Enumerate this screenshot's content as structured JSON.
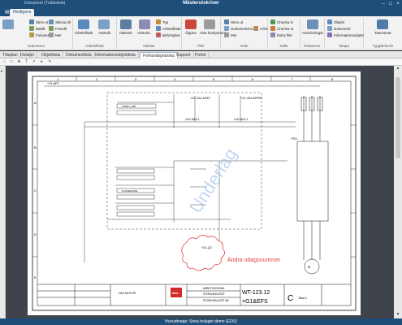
{
  "window": {
    "tab_title": "Dokument (Tvådiskett)",
    "app_title": "Mästerutskriver"
  },
  "ribbon": {
    "tabs": [
      {
        "label": "Redigera",
        "active": true
      }
    ],
    "groups": [
      {
        "label": "Dokument",
        "items": [
          "Skriv ut",
          "Skicka till",
          "Bakåt",
          "Framåt",
          "Fokuserad",
          "Mer"
        ]
      },
      {
        "label": "Arbetsflöde",
        "items": [
          "Arbetsflöde",
          "Historik"
        ]
      },
      {
        "label": "Nästan",
        "items": [
          "Nätverk",
          "Historia",
          "Typ",
          "Arbetsflöde",
          "Behörighet"
        ]
      },
      {
        "label": "PDF",
        "items": [
          "Öppna",
          "Visa komponent"
        ]
      },
      {
        "label": "Anter",
        "items": [
          "Skriv ut",
          "Dokumentera",
          "Mer",
          "Arkiv"
        ]
      },
      {
        "label": "Källa",
        "items": [
          "Checka in",
          "Checka ut",
          "Extra filer"
        ]
      },
      {
        "label": "Relationer",
        "items": [
          "Anteckningar"
        ]
      },
      {
        "label": "Skapa",
        "items": [
          "Objekt",
          "Dokument",
          "Informationsobjekt"
        ]
      },
      {
        "label": "Typgårdsoch",
        "items": [
          "Tasuvenar"
        ]
      }
    ]
  },
  "doc_tabs": [
    {
      "label": "Tidsplan",
      "active": false
    },
    {
      "label": "Detaljer",
      "active": false
    },
    {
      "label": "Objektlista",
      "active": false
    },
    {
      "label": "Dokumentlista",
      "active": false
    },
    {
      "label": "Informationsobjektlista",
      "active": false
    },
    {
      "label": "Förhandsgranska",
      "active": true
    },
    {
      "label": "Support",
      "active": false
    },
    {
      "label": "Portal",
      "active": false
    }
  ],
  "drawing": {
    "columns": [
      "1",
      "2",
      "3",
      "4",
      "5",
      "6",
      "7",
      "8"
    ],
    "rows": [
      "A",
      "B",
      "C",
      "D",
      "E"
    ],
    "labels": {
      "top_ref": "+G1-NP1",
      "ref_5a": "+G1-XA1-MFP1",
      "ref_6a": "+G1-XB1-MFP01",
      "ref_block_a": "FPMKT_NBT",
      "ref_block_b": "PLANER/ONE",
      "wire_1": "1U1-NAX.1",
      "wire_2": "1U0-NAX.1",
      "motor": "+FE1",
      "cloud": "+G1-Q2",
      "cloud_text": "Ändra uttagsnummer"
    },
    "watermark": "Underlag",
    "title_block": {
      "company_logo": "idea",
      "doc_title": "ARBETSSCHEMA",
      "doc_sub1": "STORA BOLAGET",
      "doc_sub2": "STORA BOLAGET AB",
      "drawing_no": "WT-123.12",
      "drawing_ref": "=G1&EFS",
      "revision": "C",
      "sheet": "Blad 1",
      "mid_text": "HAX MOTOR"
    }
  },
  "status": {
    "text": "Huvudmapp: Stora bolaget demo (EDU)"
  },
  "colors": {
    "titlebar": "#1f4e7a",
    "revision_cloud": "#e04040",
    "watermark": "#8fb8e8"
  }
}
